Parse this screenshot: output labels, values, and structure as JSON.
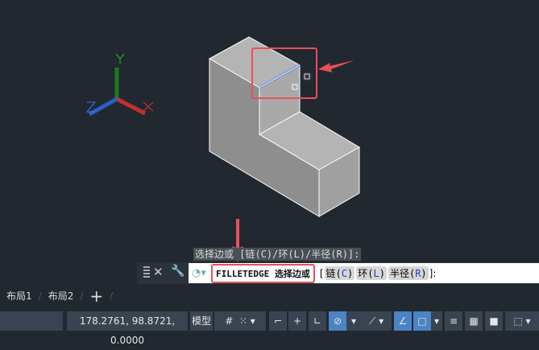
{
  "viewport": {
    "axis_labels": {
      "x": "X",
      "y": "Y",
      "z": "Z"
    }
  },
  "command": {
    "hint": "选择边或 [链(C)/环(L)/半径(R)]:",
    "input_text": "FILLETEDGE 选择边或",
    "bracket_open": "[",
    "options": [
      {
        "label": "链(",
        "key": "C",
        "end": ")"
      },
      {
        "label": "环(",
        "key": "L",
        "end": ")"
      },
      {
        "label": "半径(",
        "key": "R",
        "end": ")"
      }
    ],
    "suffix": "]:",
    "close_icon": "✕",
    "settings_icon": "wrench-icon"
  },
  "tabs": {
    "items": [
      "布局1",
      "布局2"
    ],
    "add": "+"
  },
  "status": {
    "coords": "178.2761, 98.8721, 0.0000",
    "model": "模型"
  },
  "colors": {
    "accent": "#e8505b",
    "highlight": "#4a84c4"
  }
}
